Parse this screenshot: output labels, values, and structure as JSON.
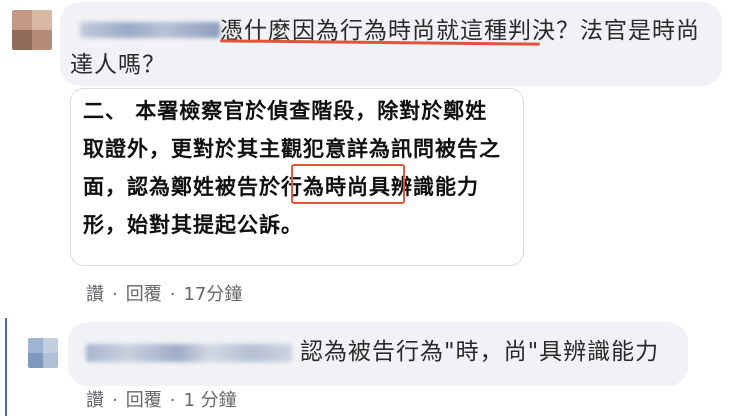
{
  "comment1": {
    "text": "憑什麼因為行為時尚就這種判決？法官是時尚達人嗎？",
    "document_lines": [
      "二、 本署檢察官於偵查階段，除對於鄭姓",
      "取證外，更對於其主觀犯意詳為訊問被告之",
      "面，認為鄭姓被告於行為時尚具辨識能力",
      "形，始對其提起公訴。"
    ],
    "actions": {
      "like": "讚",
      "reply": "回覆",
      "time": "17分鐘"
    }
  },
  "comment2": {
    "text": "認為被告行為\"時，尚\"具辨識能力",
    "actions": {
      "like": "讚",
      "reply": "回覆",
      "time": "1 分鐘"
    }
  },
  "colors": {
    "bubble": "#f0f2f5",
    "annotation": "#e0553a",
    "meta_text": "#65676b",
    "thread_line": "#4a6fa5"
  }
}
